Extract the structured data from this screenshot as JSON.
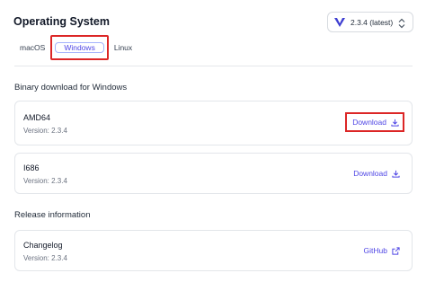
{
  "header": {
    "title": "Operating System",
    "version_select": {
      "value": "2.3.4 (latest)"
    }
  },
  "tabs": [
    {
      "label": "macOS"
    },
    {
      "label": "Windows"
    },
    {
      "label": "Linux"
    }
  ],
  "sections": {
    "binary": "Binary download for Windows",
    "release": "Release information"
  },
  "binaries": [
    {
      "name": "AMD64",
      "version": "Version: 2.3.4",
      "action": "Download"
    },
    {
      "name": "I686",
      "version": "Version: 2.3.4",
      "action": "Download"
    }
  ],
  "release": {
    "name": "Changelog",
    "version": "Version: 2.3.4",
    "action": "GitHub"
  },
  "colors": {
    "accent": "#4f46e5",
    "highlight": "#dc2626",
    "logo": "#3f3fd1"
  }
}
